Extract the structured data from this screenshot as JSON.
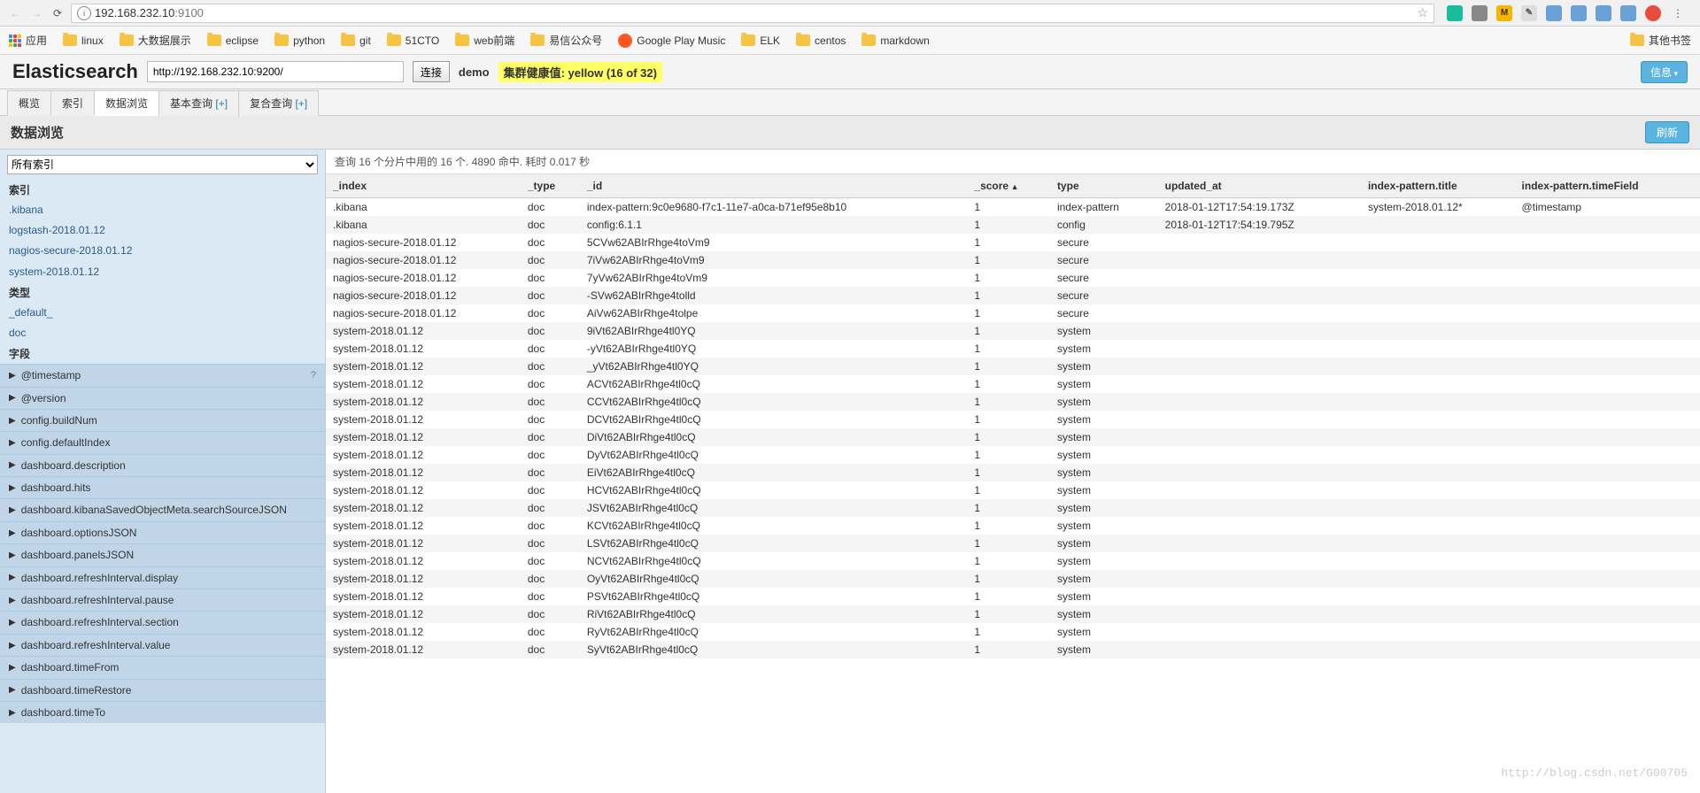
{
  "browser": {
    "url_host": "192.168.232.10",
    "url_port": ":9100",
    "other_bookmarks": "其他书签"
  },
  "bookmarks": {
    "apps": "应用",
    "items": [
      "linux",
      "大数据展示",
      "eclipse",
      "python",
      "git",
      "51CTO",
      "web前端",
      "易信公众号",
      "Google Play Music",
      "ELK",
      "centos",
      "markdown"
    ]
  },
  "es": {
    "title": "Elasticsearch",
    "url": "http://192.168.232.10:9200/",
    "connect_btn": "连接",
    "cluster_name": "demo",
    "health": "集群健康值: yellow (16 of 32)",
    "info_btn": "信息"
  },
  "tabs": {
    "overview": "概览",
    "indices": "索引",
    "browser": "数据浏览",
    "basic_query": "基本查询",
    "compound_query": "复合查询",
    "plus": "[+]"
  },
  "page": {
    "title": "数据浏览",
    "refresh": "刷新"
  },
  "sidebar": {
    "all_indices": "所有索引",
    "indices_heading": "索引",
    "indices": [
      ".kibana",
      "logstash-2018.01.12",
      "nagios-secure-2018.01.12",
      "system-2018.01.12"
    ],
    "types_heading": "类型",
    "types": [
      "_default_",
      "doc"
    ],
    "fields_heading": "字段",
    "fields": [
      "@timestamp",
      "@version",
      "config.buildNum",
      "config.defaultIndex",
      "dashboard.description",
      "dashboard.hits",
      "dashboard.kibanaSavedObjectMeta.searchSourceJSON",
      "dashboard.optionsJSON",
      "dashboard.panelsJSON",
      "dashboard.refreshInterval.display",
      "dashboard.refreshInterval.pause",
      "dashboard.refreshInterval.section",
      "dashboard.refreshInterval.value",
      "dashboard.timeFrom",
      "dashboard.timeRestore",
      "dashboard.timeTo"
    ]
  },
  "query_info": "查询 16 个分片中用的 16 个. 4890 命中. 耗时 0.017 秒",
  "columns": [
    "_index",
    "_type",
    "_id",
    "_score",
    "type",
    "updated_at",
    "index-pattern.title",
    "index-pattern.timeField"
  ],
  "rows": [
    {
      "_index": ".kibana",
      "_type": "doc",
      "_id": "index-pattern:9c0e9680-f7c1-11e7-a0ca-b71ef95e8b10",
      "_score": "1",
      "type": "index-pattern",
      "updated_at": "2018-01-12T17:54:19.173Z",
      "title": "system-2018.01.12*",
      "timeField": "@timestamp"
    },
    {
      "_index": ".kibana",
      "_type": "doc",
      "_id": "config:6.1.1",
      "_score": "1",
      "type": "config",
      "updated_at": "2018-01-12T17:54:19.795Z",
      "title": "",
      "timeField": ""
    },
    {
      "_index": "nagios-secure-2018.01.12",
      "_type": "doc",
      "_id": "5CVw62ABIrRhge4toVm9",
      "_score": "1",
      "type": "secure",
      "updated_at": "",
      "title": "",
      "timeField": ""
    },
    {
      "_index": "nagios-secure-2018.01.12",
      "_type": "doc",
      "_id": "7iVw62ABIrRhge4toVm9",
      "_score": "1",
      "type": "secure",
      "updated_at": "",
      "title": "",
      "timeField": ""
    },
    {
      "_index": "nagios-secure-2018.01.12",
      "_type": "doc",
      "_id": "7yVw62ABIrRhge4toVm9",
      "_score": "1",
      "type": "secure",
      "updated_at": "",
      "title": "",
      "timeField": ""
    },
    {
      "_index": "nagios-secure-2018.01.12",
      "_type": "doc",
      "_id": "-SVw62ABIrRhge4tolld",
      "_score": "1",
      "type": "secure",
      "updated_at": "",
      "title": "",
      "timeField": ""
    },
    {
      "_index": "nagios-secure-2018.01.12",
      "_type": "doc",
      "_id": "AiVw62ABIrRhge4tolpe",
      "_score": "1",
      "type": "secure",
      "updated_at": "",
      "title": "",
      "timeField": ""
    },
    {
      "_index": "system-2018.01.12",
      "_type": "doc",
      "_id": "9iVt62ABIrRhge4tl0YQ",
      "_score": "1",
      "type": "system",
      "updated_at": "",
      "title": "",
      "timeField": ""
    },
    {
      "_index": "system-2018.01.12",
      "_type": "doc",
      "_id": "-yVt62ABIrRhge4tl0YQ",
      "_score": "1",
      "type": "system",
      "updated_at": "",
      "title": "",
      "timeField": ""
    },
    {
      "_index": "system-2018.01.12",
      "_type": "doc",
      "_id": "_yVt62ABIrRhge4tl0YQ",
      "_score": "1",
      "type": "system",
      "updated_at": "",
      "title": "",
      "timeField": ""
    },
    {
      "_index": "system-2018.01.12",
      "_type": "doc",
      "_id": "ACVt62ABIrRhge4tl0cQ",
      "_score": "1",
      "type": "system",
      "updated_at": "",
      "title": "",
      "timeField": ""
    },
    {
      "_index": "system-2018.01.12",
      "_type": "doc",
      "_id": "CCVt62ABIrRhge4tl0cQ",
      "_score": "1",
      "type": "system",
      "updated_at": "",
      "title": "",
      "timeField": ""
    },
    {
      "_index": "system-2018.01.12",
      "_type": "doc",
      "_id": "DCVt62ABIrRhge4tl0cQ",
      "_score": "1",
      "type": "system",
      "updated_at": "",
      "title": "",
      "timeField": ""
    },
    {
      "_index": "system-2018.01.12",
      "_type": "doc",
      "_id": "DiVt62ABIrRhge4tl0cQ",
      "_score": "1",
      "type": "system",
      "updated_at": "",
      "title": "",
      "timeField": ""
    },
    {
      "_index": "system-2018.01.12",
      "_type": "doc",
      "_id": "DyVt62ABIrRhge4tl0cQ",
      "_score": "1",
      "type": "system",
      "updated_at": "",
      "title": "",
      "timeField": ""
    },
    {
      "_index": "system-2018.01.12",
      "_type": "doc",
      "_id": "EiVt62ABIrRhge4tl0cQ",
      "_score": "1",
      "type": "system",
      "updated_at": "",
      "title": "",
      "timeField": ""
    },
    {
      "_index": "system-2018.01.12",
      "_type": "doc",
      "_id": "HCVt62ABIrRhge4tl0cQ",
      "_score": "1",
      "type": "system",
      "updated_at": "",
      "title": "",
      "timeField": ""
    },
    {
      "_index": "system-2018.01.12",
      "_type": "doc",
      "_id": "JSVt62ABIrRhge4tl0cQ",
      "_score": "1",
      "type": "system",
      "updated_at": "",
      "title": "",
      "timeField": ""
    },
    {
      "_index": "system-2018.01.12",
      "_type": "doc",
      "_id": "KCVt62ABIrRhge4tl0cQ",
      "_score": "1",
      "type": "system",
      "updated_at": "",
      "title": "",
      "timeField": ""
    },
    {
      "_index": "system-2018.01.12",
      "_type": "doc",
      "_id": "LSVt62ABIrRhge4tl0cQ",
      "_score": "1",
      "type": "system",
      "updated_at": "",
      "title": "",
      "timeField": ""
    },
    {
      "_index": "system-2018.01.12",
      "_type": "doc",
      "_id": "NCVt62ABIrRhge4tl0cQ",
      "_score": "1",
      "type": "system",
      "updated_at": "",
      "title": "",
      "timeField": ""
    },
    {
      "_index": "system-2018.01.12",
      "_type": "doc",
      "_id": "OyVt62ABIrRhge4tl0cQ",
      "_score": "1",
      "type": "system",
      "updated_at": "",
      "title": "",
      "timeField": ""
    },
    {
      "_index": "system-2018.01.12",
      "_type": "doc",
      "_id": "PSVt62ABIrRhge4tl0cQ",
      "_score": "1",
      "type": "system",
      "updated_at": "",
      "title": "",
      "timeField": ""
    },
    {
      "_index": "system-2018.01.12",
      "_type": "doc",
      "_id": "RiVt62ABIrRhge4tl0cQ",
      "_score": "1",
      "type": "system",
      "updated_at": "",
      "title": "",
      "timeField": ""
    },
    {
      "_index": "system-2018.01.12",
      "_type": "doc",
      "_id": "RyVt62ABIrRhge4tl0cQ",
      "_score": "1",
      "type": "system",
      "updated_at": "",
      "title": "",
      "timeField": ""
    },
    {
      "_index": "system-2018.01.12",
      "_type": "doc",
      "_id": "SyVt62ABIrRhge4tl0cQ",
      "_score": "1",
      "type": "system",
      "updated_at": "",
      "title": "",
      "timeField": ""
    }
  ],
  "watermark": "http://blog.csdn.net/G00705"
}
